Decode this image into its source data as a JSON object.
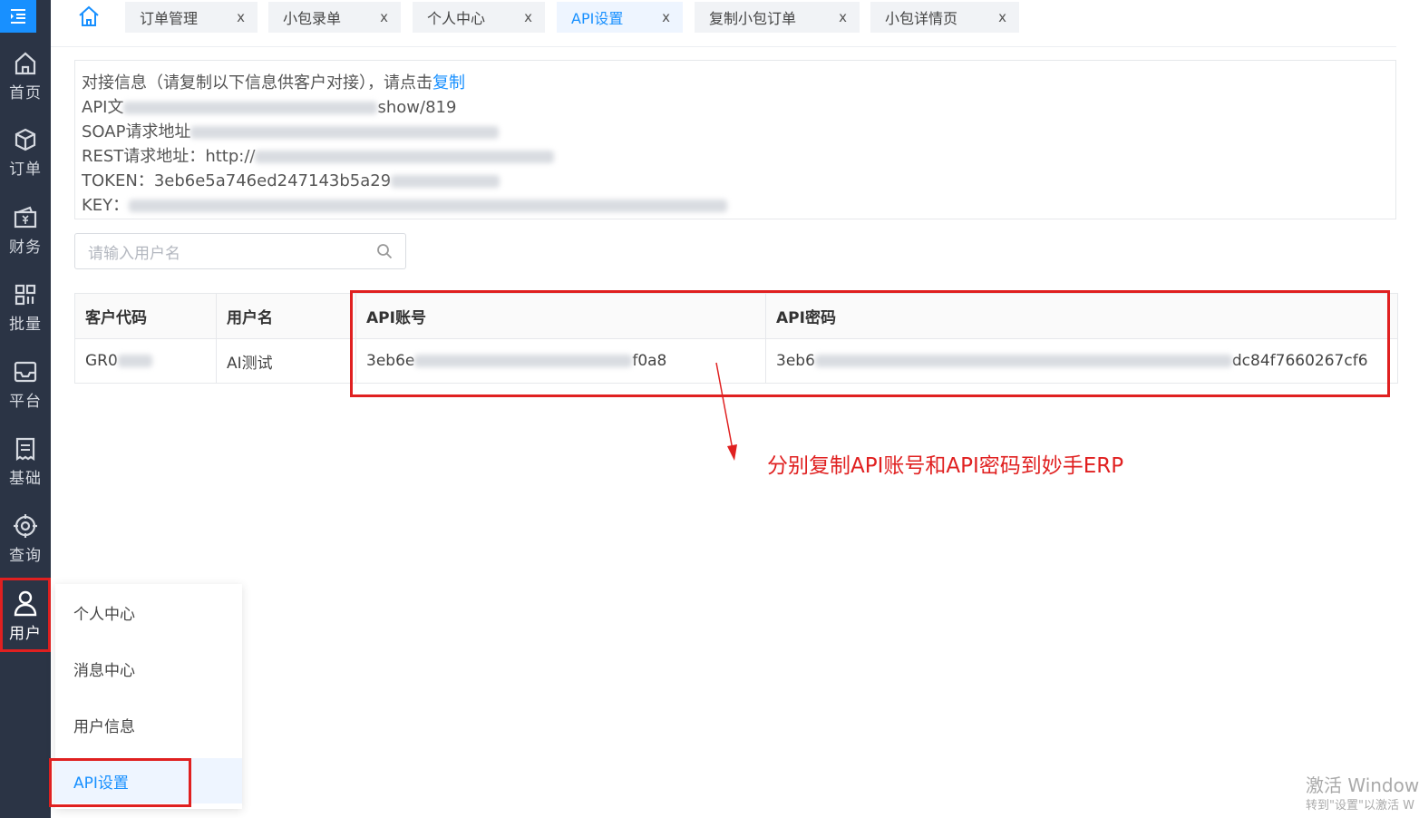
{
  "sidebar": {
    "items": [
      {
        "label": "首页",
        "icon": "home-icon"
      },
      {
        "label": "订单",
        "icon": "box-icon"
      },
      {
        "label": "财务",
        "icon": "wallet-icon"
      },
      {
        "label": "批量",
        "icon": "grid-icon"
      },
      {
        "label": "平台",
        "icon": "inbox-icon"
      },
      {
        "label": "基础",
        "icon": "document-icon"
      },
      {
        "label": "查询",
        "icon": "target-icon"
      },
      {
        "label": "用户",
        "icon": "user-icon"
      }
    ]
  },
  "tabs": [
    {
      "label": "订单管理",
      "close": "x"
    },
    {
      "label": "小包录单",
      "close": "x"
    },
    {
      "label": "个人中心",
      "close": "x"
    },
    {
      "label": "API设置",
      "close": "x"
    },
    {
      "label": "复制小包订单",
      "close": "x"
    },
    {
      "label": "小包详情页",
      "close": "x"
    }
  ],
  "info": {
    "intro": "对接信息（请复制以下信息供客户对接），请点击",
    "copy_link": "复制",
    "api_doc_prefix": "API文",
    "api_doc_suffix": "show/819",
    "soap_label": "SOAP请求地址",
    "rest_label": "REST请求地址：",
    "rest_value": "http://",
    "token_label": "TOKEN：",
    "token_value": "3eb6e5a746ed247143b5a29",
    "key_label": "KEY："
  },
  "search": {
    "placeholder": "请输入用户名"
  },
  "table": {
    "headers": [
      "客户代码",
      "用户名",
      "API账号",
      "API密码"
    ],
    "rows": [
      {
        "code": "GR0",
        "username": "AI测试",
        "api_account_start": "3eb6e",
        "api_account_end": "f0a8",
        "api_password_start": "3eb6",
        "api_password_end": "dc84f7660267cf6"
      }
    ]
  },
  "annotation": "分别复制API账号和API密码到妙手ERP",
  "user_menu": [
    "个人中心",
    "消息中心",
    "用户信息",
    "API设置"
  ],
  "watermark": {
    "line1": "激活 Window",
    "line2": "转到\"设置\"以激活 W"
  },
  "colors": {
    "accent": "#1890ff",
    "sidebar_bg": "#2b3445",
    "highlight": "#e02020"
  }
}
